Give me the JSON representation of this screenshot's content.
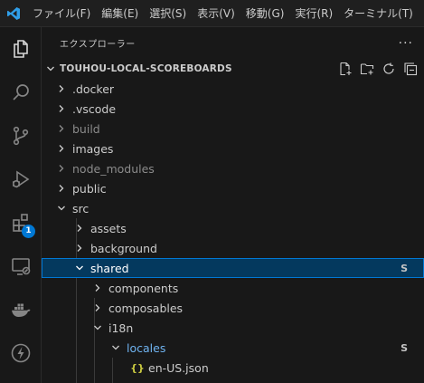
{
  "menu": {
    "items": [
      "ファイル(F)",
      "編集(E)",
      "選択(S)",
      "表示(V)",
      "移動(G)",
      "実行(R)",
      "ターミナル(T)"
    ]
  },
  "activity_bar": {
    "items": [
      {
        "name": "explorer",
        "icon": "files-icon"
      },
      {
        "name": "search",
        "icon": "search-icon"
      },
      {
        "name": "source-control",
        "icon": "source-control-icon"
      },
      {
        "name": "run-and-debug",
        "icon": "run-debug-icon"
      },
      {
        "name": "extensions",
        "icon": "extensions-icon",
        "badge": "1"
      },
      {
        "name": "remote-explorer",
        "icon": "remote-explorer-icon"
      },
      {
        "name": "docker",
        "icon": "docker-icon"
      },
      {
        "name": "thunder-client",
        "icon": "lightning-icon"
      }
    ]
  },
  "sidebar": {
    "title": "エクスプローラー",
    "more": "···",
    "section": {
      "title": "TOUHOU-LOCAL-SCOREBOARDS"
    },
    "tree": [
      {
        "label": ".docker",
        "kind": "folder",
        "depth": 0,
        "expanded": false
      },
      {
        "label": ".vscode",
        "kind": "folder",
        "depth": 0,
        "expanded": false
      },
      {
        "label": "build",
        "kind": "folder",
        "depth": 0,
        "expanded": false,
        "dimmed": true
      },
      {
        "label": "images",
        "kind": "folder",
        "depth": 0,
        "expanded": false
      },
      {
        "label": "node_modules",
        "kind": "folder",
        "depth": 0,
        "expanded": false,
        "dimmed": true
      },
      {
        "label": "public",
        "kind": "folder",
        "depth": 0,
        "expanded": false
      },
      {
        "label": "src",
        "kind": "folder",
        "depth": 0,
        "expanded": true
      },
      {
        "label": "assets",
        "kind": "folder",
        "depth": 1,
        "expanded": false
      },
      {
        "label": "background",
        "kind": "folder",
        "depth": 1,
        "expanded": false
      },
      {
        "label": "shared",
        "kind": "folder",
        "depth": 1,
        "expanded": true,
        "selected": true,
        "decoration": "S"
      },
      {
        "label": "components",
        "kind": "folder",
        "depth": 2,
        "expanded": false
      },
      {
        "label": "composables",
        "kind": "folder",
        "depth": 2,
        "expanded": false
      },
      {
        "label": "i18n",
        "kind": "folder",
        "depth": 2,
        "expanded": true
      },
      {
        "label": "locales",
        "kind": "folder",
        "depth": 3,
        "expanded": true,
        "blue": true,
        "decoration": "S"
      },
      {
        "label": "en-US.json",
        "kind": "file",
        "depth": 4,
        "file_icon": "{}"
      }
    ]
  },
  "colors": {
    "accent": "#0078d4",
    "selection_bg": "#04395e",
    "json_icon": "#cbcb41"
  }
}
